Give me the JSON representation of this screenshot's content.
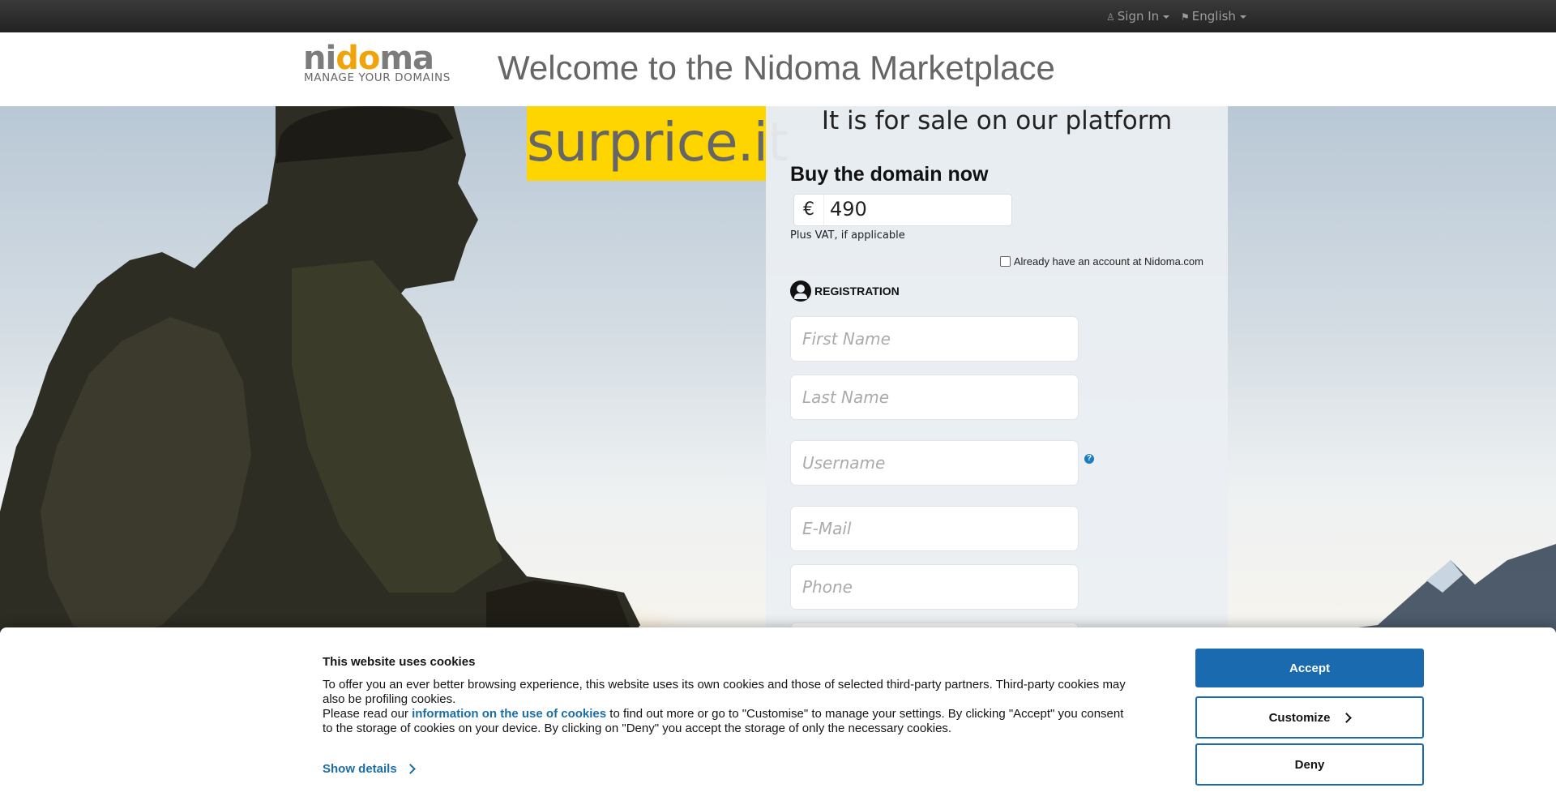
{
  "topbar": {
    "sign_in": "Sign In",
    "language": "English"
  },
  "header": {
    "logo_word_pre": "ni",
    "logo_word_o": "do",
    "logo_word_post": "ma",
    "logo_tagline": "MANAGE YOUR DOMAINS",
    "title": "Welcome to the Nidoma Marketplace"
  },
  "hero": {
    "domain": "surprice.it"
  },
  "offer": {
    "sale_text": "It is for sale on our platform",
    "buy_heading": "Buy the domain now",
    "currency": "€",
    "price": "490",
    "vat_note": "Plus VAT, if applicable",
    "account_checkbox_label": "Already have an account at Nidoma.com",
    "registration_label": "REGISTRATION"
  },
  "form": {
    "first_name_placeholder": "First Name",
    "last_name_placeholder": "Last Name",
    "username_placeholder": "Username",
    "email_placeholder": "E-Mail",
    "phone_placeholder": "Phone",
    "help_symbol": "?"
  },
  "cookies": {
    "title": "This website uses cookies",
    "text_1": "To offer you an ever better browsing experience, this website uses its own cookies and those of selected third-party partners. Third-party cookies may also be profiling cookies.",
    "text_2_pre": "Please read our ",
    "text_2_link": "information on the use of cookies",
    "text_2_post": " to find out more or go to \"Customise\" to manage your settings. By clicking \"Accept\" you consent to the storage of cookies on your device. By clicking on \"Deny\" you accept the storage of only the necessary cookies.",
    "show_details": "Show details",
    "accept": "Accept",
    "customize": "Customize",
    "deny": "Deny"
  },
  "colors": {
    "brand_orange": "#f0a30a",
    "domain_yellow": "#ffd500",
    "cookie_blue": "#1a6ab0"
  },
  "icons": [
    "user-icon",
    "flag-icon",
    "caret-down-icon",
    "user-circle-icon",
    "question-icon",
    "chevron-right-icon"
  ]
}
